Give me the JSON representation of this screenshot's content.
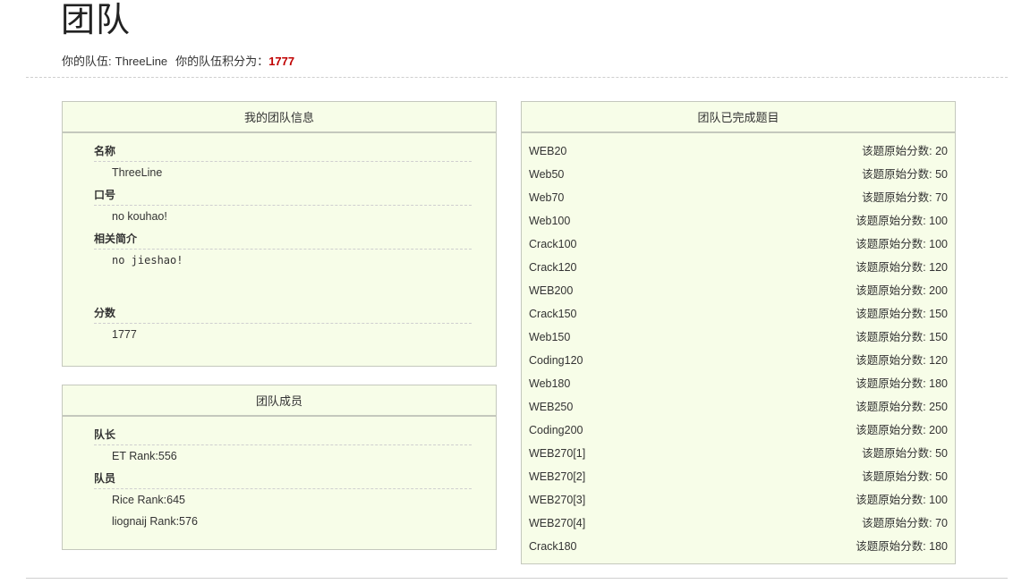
{
  "header": {
    "title": "团队",
    "team_label": "你的队伍:",
    "team_name": "ThreeLine",
    "score_label": "你的队伍积分为：",
    "score_value": "1777"
  },
  "info_panel": {
    "title": "我的团队信息",
    "name_label": "名称",
    "name_value": "ThreeLine",
    "motto_label": "口号",
    "motto_value": "no kouhao!",
    "intro_label": "相关简介",
    "intro_value": "no jieshao!",
    "score_label": "分数",
    "score_value": "1777"
  },
  "members_panel": {
    "title": "团队成员",
    "leader_label": "队长",
    "leader": "ET Rank:556",
    "members_label": "队员",
    "members": [
      "Rice Rank:645",
      "liognaij Rank:576"
    ]
  },
  "solved_panel": {
    "title": "团队已完成题目",
    "items": [
      {
        "name": "WEB20",
        "score": "该题原始分数: 20"
      },
      {
        "name": "Web50",
        "score": "该题原始分数: 50"
      },
      {
        "name": "Web70",
        "score": "该题原始分数: 70"
      },
      {
        "name": "Web100",
        "score": "该题原始分数: 100"
      },
      {
        "name": "Crack100",
        "score": "该题原始分数: 100"
      },
      {
        "name": "Crack120",
        "score": "该题原始分数: 120"
      },
      {
        "name": "WEB200",
        "score": "该题原始分数: 200"
      },
      {
        "name": "Crack150",
        "score": "该题原始分数: 150"
      },
      {
        "name": "Web150",
        "score": "该题原始分数: 150"
      },
      {
        "name": "Coding120",
        "score": "该题原始分数: 120"
      },
      {
        "name": "Web180",
        "score": "该题原始分数: 180"
      },
      {
        "name": "WEB250",
        "score": "该题原始分数: 250"
      },
      {
        "name": "Coding200",
        "score": "该题原始分数: 200"
      },
      {
        "name": "WEB270[1]",
        "score": "该题原始分数: 50"
      },
      {
        "name": "WEB270[2]",
        "score": "该题原始分数: 50"
      },
      {
        "name": "WEB270[3]",
        "score": "该题原始分数: 100"
      },
      {
        "name": "WEB270[4]",
        "score": "该题原始分数: 70"
      },
      {
        "name": "Crack180",
        "score": "该题原始分数: 180"
      }
    ]
  }
}
